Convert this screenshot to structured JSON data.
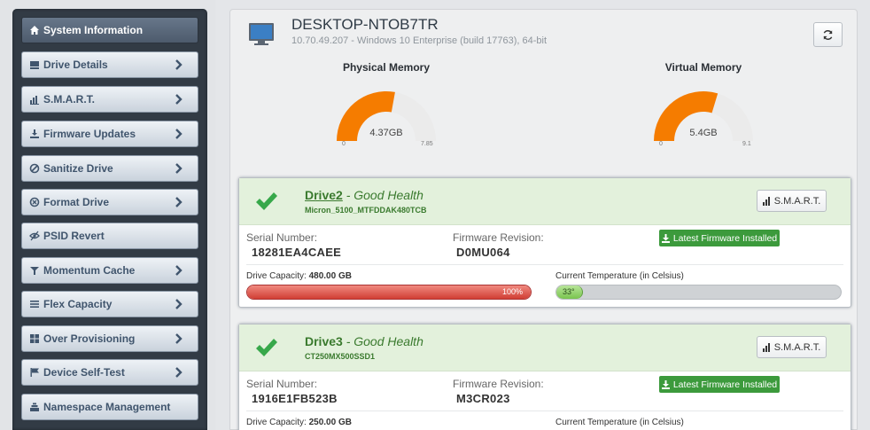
{
  "sidebar": {
    "items": [
      {
        "label": "System Information",
        "icon": "home-icon",
        "active": true,
        "chevron": false
      },
      {
        "label": "Drive Details",
        "icon": "drive-icon",
        "active": false,
        "chevron": true
      },
      {
        "label": "S.M.A.R.T.",
        "icon": "bar-chart-icon",
        "active": false,
        "chevron": true
      },
      {
        "label": "Firmware Updates",
        "icon": "download-icon",
        "active": false,
        "chevron": true
      },
      {
        "label": "Sanitize Drive",
        "icon": "ban-icon",
        "active": false,
        "chevron": true
      },
      {
        "label": "Format Drive",
        "icon": "circle-x-icon",
        "active": false,
        "chevron": true
      },
      {
        "label": "PSID Revert",
        "icon": "eye-slash-icon",
        "active": false,
        "chevron": false
      },
      {
        "label": "Momentum Cache",
        "icon": "filter-icon",
        "active": false,
        "chevron": true
      },
      {
        "label": "Flex Capacity",
        "icon": "list-icon",
        "active": false,
        "chevron": true
      },
      {
        "label": "Over Provisioning",
        "icon": "grid-icon",
        "active": false,
        "chevron": true
      },
      {
        "label": "Device Self-Test",
        "icon": "flag-icon",
        "active": false,
        "chevron": true
      },
      {
        "label": "Namespace Management",
        "icon": "stack-icon",
        "active": false,
        "chevron": false
      }
    ]
  },
  "system": {
    "hostname": "DESKTOP-NTOB7TR",
    "info": "10.70.49.207 - Windows 10 Enterprise (build 17763), 64-bit"
  },
  "gauges": {
    "physical": {
      "title": "Physical Memory",
      "value": 4.37,
      "value_label": "4.37GB",
      "min": "0",
      "max": "7.85",
      "max_value": 7.85
    },
    "virtual": {
      "title": "Virtual Memory",
      "value": 5.4,
      "value_label": "5.4GB",
      "min": "0",
      "max": "9.1",
      "max_value": 9.1
    }
  },
  "drives": [
    {
      "name": "Drive2",
      "health": " - Good Health",
      "model": "Micron_5100_MTFDDAK480TCB",
      "smart_label": "S.M.A.R.T.",
      "serial_label": "Serial Number:",
      "serial": "18281EA4CAEE",
      "fw_label": "Firmware Revision:",
      "fw": "D0MU064",
      "fw_badge": "Latest Firmware Installed",
      "cap_label": "Drive Capacity:",
      "capacity": "480.00 GB",
      "cap_pct": 100,
      "cap_pct_label": "100%",
      "temp_label": "Current Temperature (in Celsius)",
      "temp": 33,
      "temp_text": "33°"
    },
    {
      "name": "Drive3",
      "health": " - Good Health",
      "model": "CT250MX500SSD1",
      "smart_label": "S.M.A.R.T.",
      "serial_label": "Serial Number:",
      "serial": "1916E1FB523B",
      "fw_label": "Firmware Revision:",
      "fw": "M3CR023",
      "fw_badge": "Latest Firmware Installed",
      "cap_label": "Drive Capacity:",
      "capacity": "250.00 GB",
      "temp_label": "Current Temperature (in Celsius)"
    }
  ],
  "colors": {
    "gauge_fill": "#f57c00",
    "capacity_bar": "#d13f34",
    "temp_bar": "#79c44e",
    "health_green": "#3a7a2e",
    "badge_green": "#3c9a3c"
  }
}
